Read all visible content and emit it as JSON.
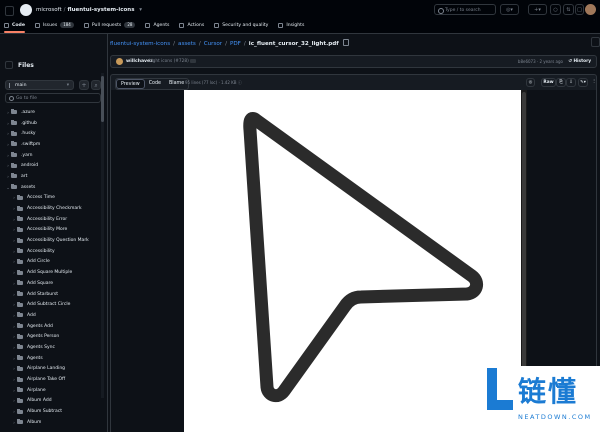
{
  "header": {
    "owner": "microsoft",
    "separator": "/",
    "repo": "fluentui-system-icons",
    "search_placeholder": "Type / to search"
  },
  "tabs": [
    {
      "label": "Code",
      "icon": "code-icon"
    },
    {
      "label": "Issues",
      "count": "184",
      "icon": "issue-icon"
    },
    {
      "label": "Pull requests",
      "count": "28",
      "icon": "pull-request-icon"
    },
    {
      "label": "Agents",
      "icon": "agents-icon"
    },
    {
      "label": "Actions",
      "icon": "play-icon"
    },
    {
      "label": "Security and quality",
      "icon": "shield-icon"
    },
    {
      "label": "Insights",
      "icon": "graph-icon"
    }
  ],
  "sidebar": {
    "title": "Files",
    "branch": "main",
    "goto_placeholder": "Go to file",
    "tree": [
      {
        "label": ".azure",
        "level": 0
      },
      {
        "label": ".github",
        "level": 0
      },
      {
        "label": ".husky",
        "level": 0
      },
      {
        "label": ".swiftpm",
        "level": 0
      },
      {
        "label": ".yarn",
        "level": 0
      },
      {
        "label": "android",
        "level": 0
      },
      {
        "label": "art",
        "level": 0
      },
      {
        "label": "assets",
        "level": 0,
        "expanded": true
      },
      {
        "label": "Access Time",
        "level": 1
      },
      {
        "label": "Accessibility Checkmark",
        "level": 1
      },
      {
        "label": "Accessibility Error",
        "level": 1
      },
      {
        "label": "Accessibility More",
        "level": 1
      },
      {
        "label": "Accessibility Question Mark",
        "level": 1
      },
      {
        "label": "Accessibility",
        "level": 1
      },
      {
        "label": "Add Circle",
        "level": 1
      },
      {
        "label": "Add Square Multiple",
        "level": 1
      },
      {
        "label": "Add Square",
        "level": 1
      },
      {
        "label": "Add Starburst",
        "level": 1
      },
      {
        "label": "Add Subtract Circle",
        "level": 1
      },
      {
        "label": "Add",
        "level": 1
      },
      {
        "label": "Agents Add",
        "level": 1
      },
      {
        "label": "Agents Person",
        "level": 1
      },
      {
        "label": "Agents Sync",
        "level": 1
      },
      {
        "label": "Agents",
        "level": 1
      },
      {
        "label": "Airplane Landing",
        "level": 1
      },
      {
        "label": "Airplane Take Off",
        "level": 1
      },
      {
        "label": "Airplane",
        "level": 1
      },
      {
        "label": "Album Add",
        "level": 1
      },
      {
        "label": "Album Subtract",
        "level": 1
      },
      {
        "label": "Album",
        "level": 1
      }
    ]
  },
  "breadcrumb": {
    "items": [
      "fluentui-system-icons",
      "assets",
      "Cursor",
      "PDF"
    ],
    "separator": "/",
    "current": "ic_fluent_cursor_32_light.pdf"
  },
  "commit": {
    "author": "willchavez",
    "message": "Light icons (#728)",
    "meta": "b8e6073 · 2 years ago",
    "history_label": "History"
  },
  "file": {
    "views": [
      "Preview",
      "Code",
      "Blame"
    ],
    "info": "95 lines (77 loc) · 1.42 KB",
    "raw_label": "Raw"
  },
  "watermark": {
    "chinese": "链懂",
    "english": "NEATDOWN.COM"
  },
  "colors": {
    "background": "#0d1117",
    "header": "#010409",
    "border": "#30363d",
    "link": "#4493f8",
    "active_tab_underline": "#f78166",
    "cursor_stroke": "#2b2b2b",
    "watermark": "#1b7bd3"
  }
}
